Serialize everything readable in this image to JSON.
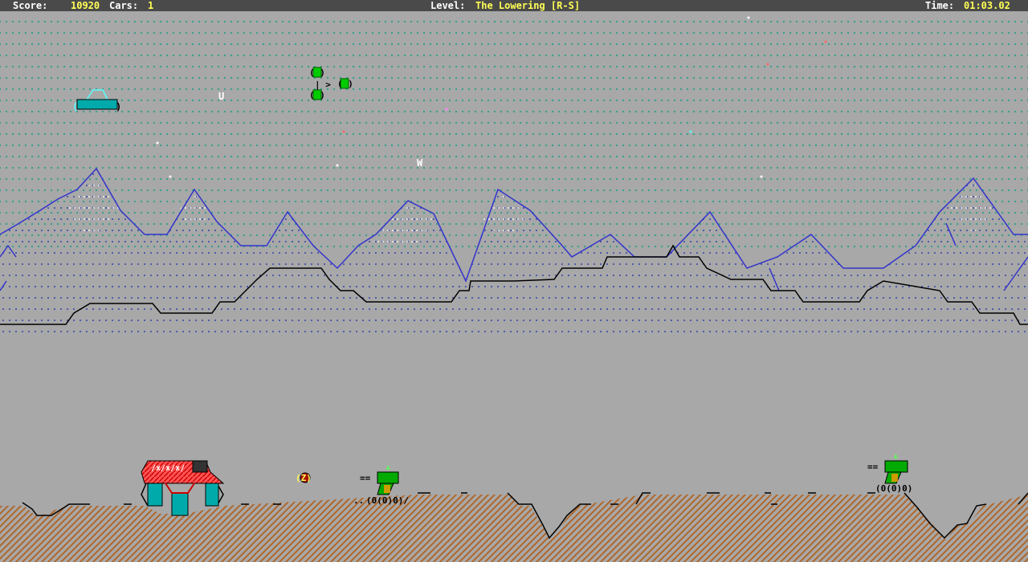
{
  "status": {
    "score_label": "Score:",
    "score": "10920",
    "cars_label": "Cars:",
    "cars": "1",
    "level_label": "Level:",
    "level": "The Lowering [R-S]",
    "time_label": "Time:",
    "time": "01:03.02"
  },
  "sky_letters": {
    "u": "U",
    "w": "W"
  },
  "colors": {
    "sky_dots": "#3aa08a",
    "mountain_line": "#3333cc",
    "mountain_fill": "#a0a0a8",
    "ground_brown": "#b0672a",
    "player_red": "#ff4444",
    "player_teal": "#00aaaa",
    "enemy_green": "#33cc33"
  },
  "sprites": {
    "flying_car": "_/Z\\\n(Z____)",
    "mine_text": "(Z)",
    "tank_left_top": "==(Z)",
    "tank_left_bottom": "(0(0)0)/",
    "tank_right_top": "==(Z)",
    "tank_right_bottom": "(0(0)0)"
  }
}
